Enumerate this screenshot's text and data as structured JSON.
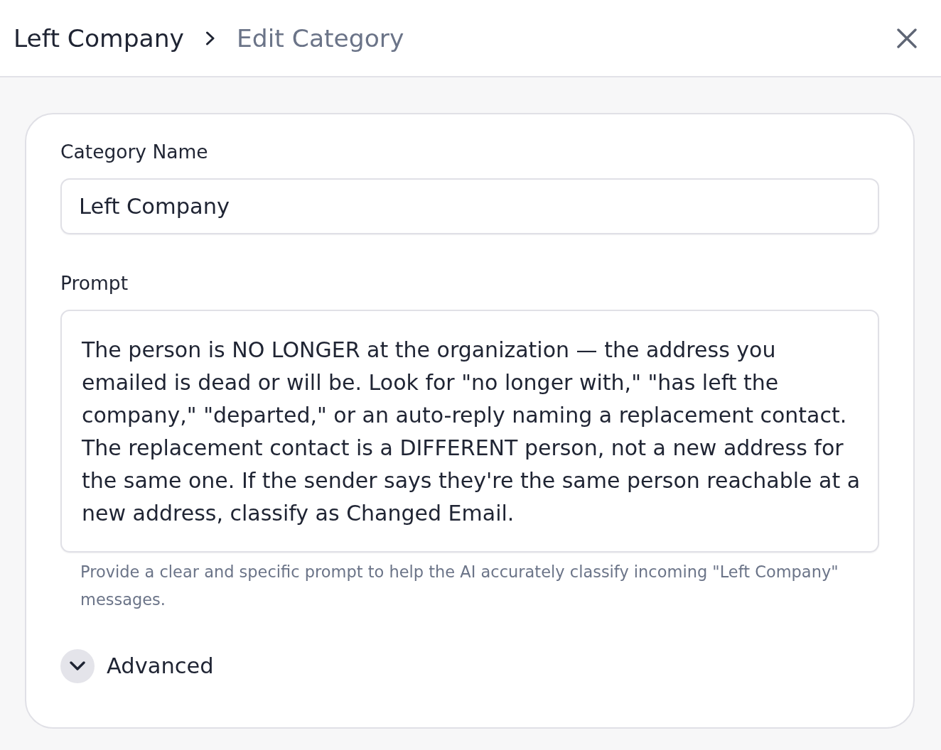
{
  "header": {
    "breadcrumb": [
      {
        "label": "Left Company",
        "current": false
      },
      {
        "label": "Edit Category",
        "current": true
      }
    ]
  },
  "form": {
    "fields": [
      {
        "kind": "input",
        "label": "Category Name",
        "value": "Left Company"
      },
      {
        "kind": "textarea",
        "label": "Prompt",
        "value": "The person is NO LONGER at the organization — the address you emailed is dead or will be. Look for \"no longer with,\" \"has left the company,\" \"departed,\" or an auto-reply naming a replacement contact. The replacement contact is a DIFFERENT person, not a new address for the same one. If the sender says they're the same person reachable at a new address, classify as Changed Email.",
        "help": "Provide a clear and specific prompt to help the AI accurately classify incoming \"Left Company\" messages."
      }
    ],
    "advanced": {
      "label": "Advanced",
      "expanded": false
    }
  }
}
